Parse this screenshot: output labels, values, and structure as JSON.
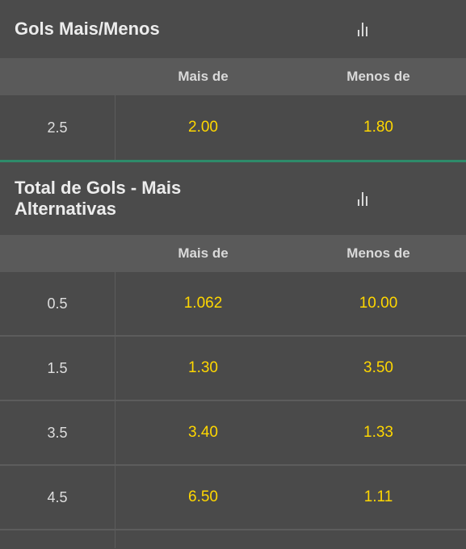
{
  "market1": {
    "title": "Gols Mais/Menos",
    "stats_icon": "bar-chart-icon",
    "col_over": "Mais de",
    "col_under": "Menos de",
    "rows": [
      {
        "line": "2.5",
        "over": "2.00",
        "under": "1.80"
      }
    ]
  },
  "market2": {
    "title": "Total de Gols - Mais Alternativas",
    "stats_icon": "bar-chart-icon",
    "col_over": "Mais de",
    "col_under": "Menos de",
    "rows": [
      {
        "line": "0.5",
        "over": "1.062",
        "under": "10.00"
      },
      {
        "line": "1.5",
        "over": "1.30",
        "under": "3.50"
      },
      {
        "line": "3.5",
        "over": "3.40",
        "under": "1.33"
      },
      {
        "line": "4.5",
        "over": "6.50",
        "under": "1.11"
      }
    ]
  },
  "colors": {
    "odds": "#ffd700",
    "separator": "#2e8b6a",
    "background": "#4a4a4a",
    "column_header_bg": "#5a5a5a"
  }
}
